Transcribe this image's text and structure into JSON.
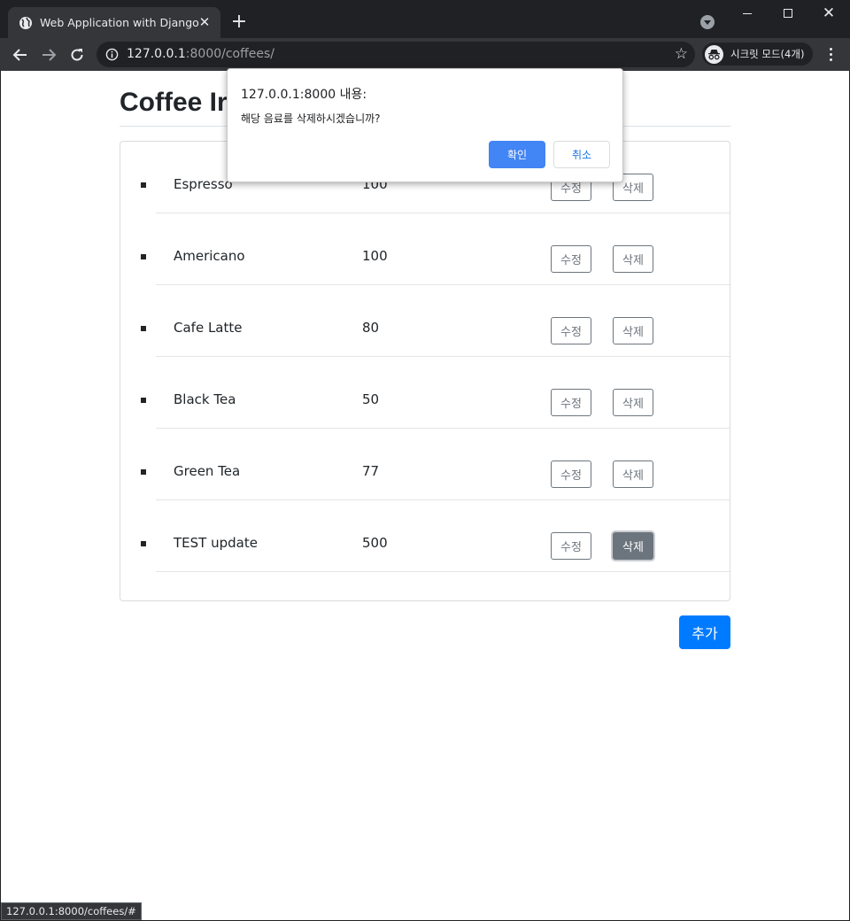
{
  "browser": {
    "tab_title": "Web Application with Django",
    "url_host": "127.0.0.1",
    "url_path": ":8000/coffees/",
    "incognito_label": "시크릿 모드(4개)",
    "status_url": "127.0.0.1:8000/coffees/#"
  },
  "page": {
    "title": "Coffee Ir",
    "add_button": "추가",
    "edit_label": "수정",
    "delete_label": "삭제",
    "items": [
      {
        "name": "Espresso",
        "price": "100"
      },
      {
        "name": "Americano",
        "price": "100"
      },
      {
        "name": "Cafe Latte",
        "price": "80"
      },
      {
        "name": "Black Tea",
        "price": "50"
      },
      {
        "name": "Green Tea",
        "price": "77"
      },
      {
        "name": "TEST update",
        "price": "500"
      }
    ]
  },
  "dialog": {
    "title": "127.0.0.1:8000 내용:",
    "message": "해당 음료를 삭제하시겠습니까?",
    "ok_label": "확인",
    "cancel_label": "취소"
  },
  "colors": {
    "primary": "#007bff",
    "secondary": "#6c757d",
    "dialog_ok": "#4285f4",
    "chrome_dark": "#202124"
  }
}
